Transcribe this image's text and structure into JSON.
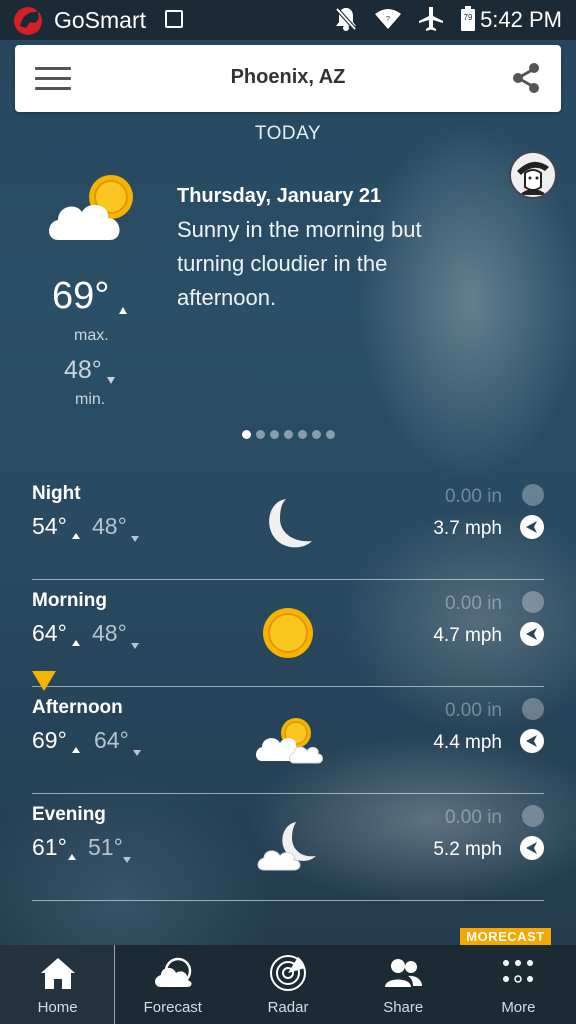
{
  "status_bar": {
    "carrier": "GoSmart",
    "battery": "79",
    "time": "5:42 PM"
  },
  "app_bar": {
    "location": "Phoenix, AZ"
  },
  "today_label": "TODAY",
  "summary": {
    "date": "Thursday, January 21",
    "description": "Sunny in the morning but turning cloudier in the afternoon.",
    "max_temp": "69°",
    "max_label": "max.",
    "min_temp": "48°",
    "min_label": "min.",
    "icon": "partly-cloudy-day-icon",
    "page_count": 7,
    "active_page": 0
  },
  "periods": [
    {
      "name": "Night",
      "high": "54°",
      "low": "48°",
      "rain": "0.00 in",
      "wind": "3.7 mph",
      "icon": "moon-icon"
    },
    {
      "name": "Morning",
      "high": "64°",
      "low": "48°",
      "rain": "0.00 in",
      "wind": "4.7 mph",
      "icon": "sun-icon"
    },
    {
      "name": "Afternoon",
      "high": "69°",
      "low": "64°",
      "rain": "0.00 in",
      "wind": "4.4 mph",
      "icon": "partly-cloudy-day-icon"
    },
    {
      "name": "Evening",
      "high": "61°",
      "low": "51°",
      "rain": "0.00 in",
      "wind": "5.2 mph",
      "icon": "partly-cloudy-night-icon"
    }
  ],
  "brand_tag": "MORECAST",
  "nav": [
    {
      "label": "Home",
      "icon": "home-icon"
    },
    {
      "label": "Forecast",
      "icon": "forecast-icon"
    },
    {
      "label": "Radar",
      "icon": "radar-icon"
    },
    {
      "label": "Share",
      "icon": "people-icon"
    },
    {
      "label": "More",
      "icon": "more-dots-icon"
    }
  ],
  "colors": {
    "accent": "#f4b400",
    "sun": "#f5b400",
    "status_bar": "#1b2a35",
    "nav_bar": "#1c2a34"
  }
}
